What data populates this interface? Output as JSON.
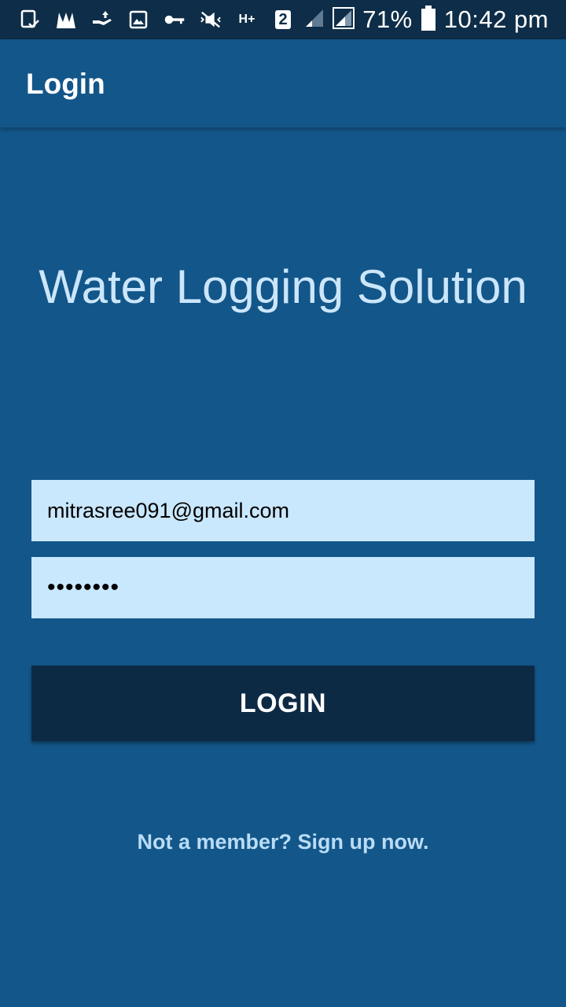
{
  "status_bar": {
    "icons": [
      "screen-check-icon",
      "m-logo-icon",
      "hand-upload-icon",
      "image-icon",
      "key-icon",
      "mute-icon",
      "hplus-data-icon",
      "sim2-icon",
      "signal-weak-icon",
      "signal-icon",
      "battery-icon"
    ],
    "sim_label": "2",
    "data_label": "H+",
    "battery": "71%",
    "time": "10:42 pm"
  },
  "app_bar": {
    "title": "Login"
  },
  "main": {
    "app_title": "Water Logging Solution",
    "email_value": "mitrasree091@gmail.com",
    "password_value": "12345678",
    "login_label": "LOGIN",
    "signup_text": "Not a member? Sign up now."
  },
  "colors": {
    "background": "#135689",
    "status_bar": "#0e2d48",
    "input_bg": "#c9e7fd",
    "button_bg": "#0d2a45",
    "title_text": "#cbe6fb"
  }
}
